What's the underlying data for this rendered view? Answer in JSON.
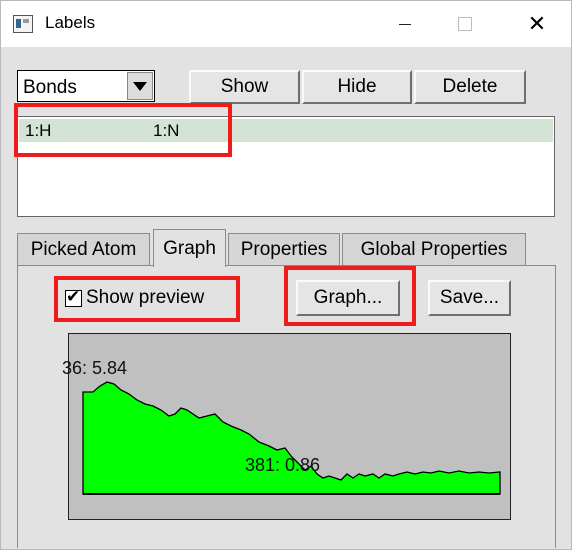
{
  "window": {
    "title": "Labels"
  },
  "selector": {
    "value": "Bonds"
  },
  "actions": {
    "show": "Show",
    "hide": "Hide",
    "delete": "Delete"
  },
  "list": {
    "rows": [
      {
        "atom1": "1:H",
        "atom2": "1:N",
        "selected": true
      }
    ]
  },
  "tabs": [
    {
      "label": "Picked Atom"
    },
    {
      "label": "Graph",
      "active": true
    },
    {
      "label": "Properties"
    },
    {
      "label": "Global Properties"
    }
  ],
  "graph_panel": {
    "show_preview_label": "Show preview",
    "show_preview_checked": true,
    "graph_button": "Graph...",
    "save_button": "Save...",
    "max_label": "36: 5.84",
    "min_label": "381: 0.86",
    "colors": {
      "fill": "#00ff00",
      "background": "#c0c0c0",
      "highlight": "#ef1c1c"
    }
  }
}
